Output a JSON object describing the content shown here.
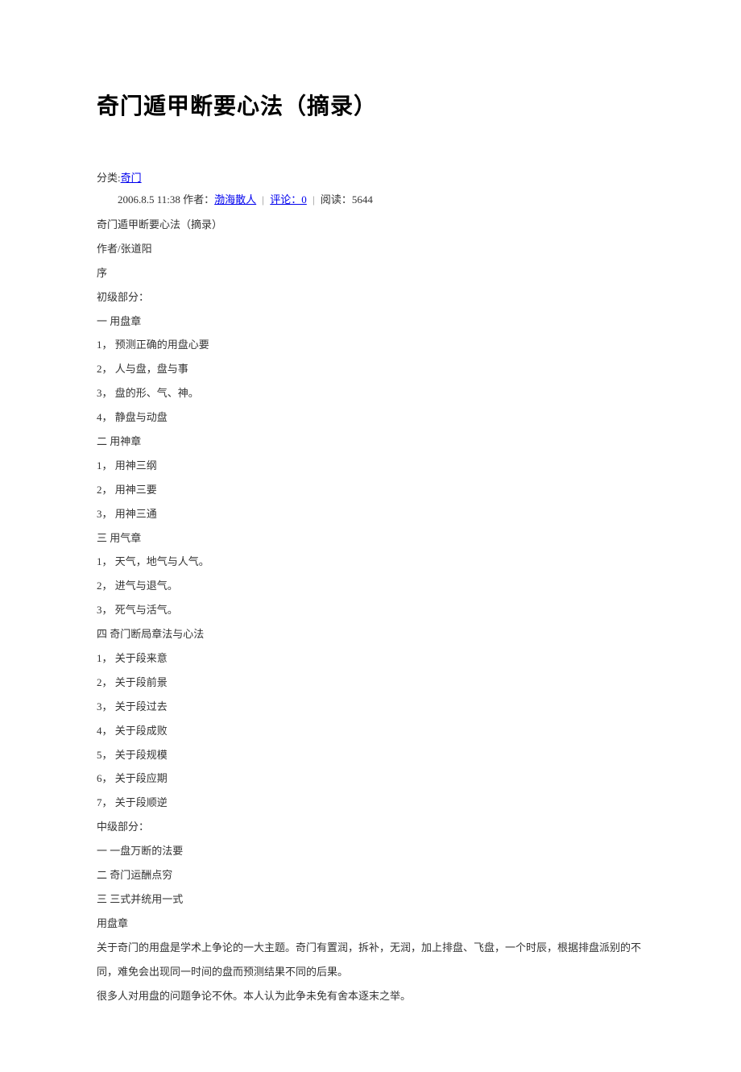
{
  "title": "奇门遁甲断要心法（摘录）",
  "category": {
    "label": "分类:",
    "link": "奇门"
  },
  "meta": {
    "timestamp": "2006.8.5 11:38",
    "author_label": "作者：",
    "author_link": "渤海散人",
    "comments_label": "评论：0",
    "reads_label": "阅读：5644"
  },
  "lines": [
    "奇门遁甲断要心法（摘录）",
    "作者/张道阳",
    "序",
    "初级部分：",
    "一  用盘章",
    "1，   预测正确的用盘心要",
    "2，   人与盘，盘与事",
    "3，   盘的形、气、神。",
    "4，   静盘与动盘",
    "二  用神章",
    "1，   用神三纲",
    "2，   用神三要",
    "3，   用神三通",
    "三  用气章",
    "1，   天气，地气与人气。",
    "2，   进气与退气。",
    "3，   死气与活气。",
    "四 奇门断局章法与心法",
    "1，   关于段来意",
    "2，   关于段前景",
    "3，   关于段过去",
    "4，   关于段成败",
    "5，   关于段规模",
    "6，   关于段应期",
    "7，   关于段顺逆",
    "中级部分：",
    "一  一盘万断的法要",
    "二  奇门运酬点穷",
    "三  三式并统用一式",
    "用盘章",
    "关于奇门的用盘是学术上争论的一大主题。奇门有置润，拆补，无润，加上排盘、飞盘，一个时辰，根据排盘派别的不同，难免会出现同一时间的盘而预测结果不同的后果。",
    "很多人对用盘的问题争论不休。本人认为此争未免有舍本逐末之举。"
  ]
}
